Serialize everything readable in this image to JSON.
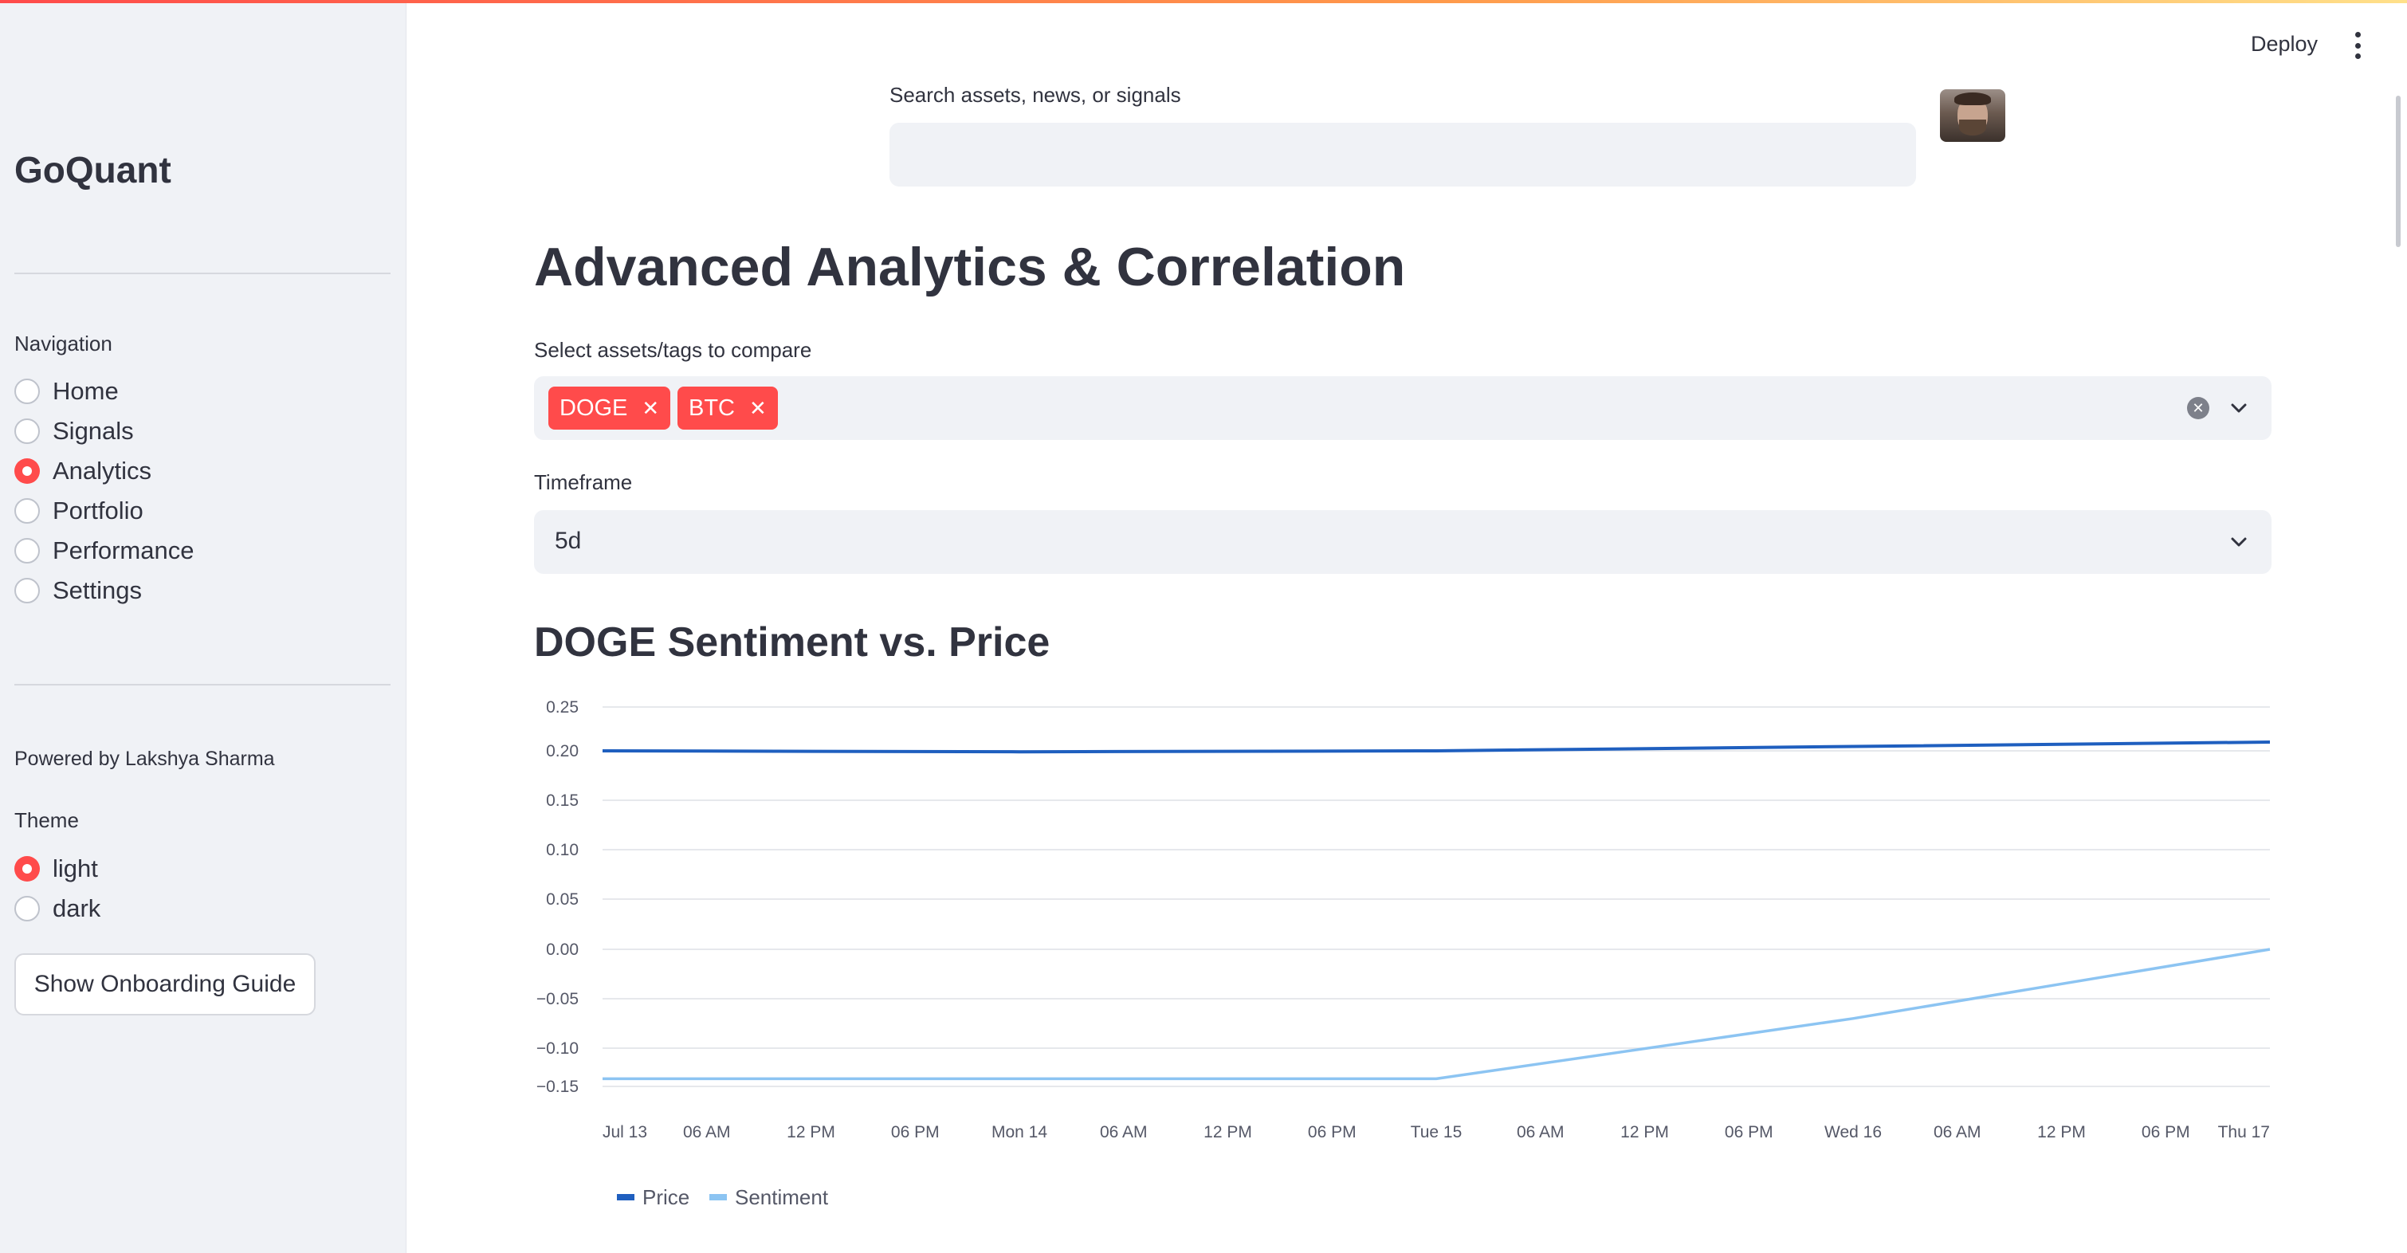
{
  "app": {
    "brand": "GoQuant",
    "deploy_label": "Deploy"
  },
  "sidebar": {
    "navigation_label": "Navigation",
    "nav_items": [
      {
        "label": "Home",
        "selected": false
      },
      {
        "label": "Signals",
        "selected": false
      },
      {
        "label": "Analytics",
        "selected": true
      },
      {
        "label": "Portfolio",
        "selected": false
      },
      {
        "label": "Performance",
        "selected": false
      },
      {
        "label": "Settings",
        "selected": false
      }
    ],
    "powered_by": "Powered by Lakshya Sharma",
    "theme_label": "Theme",
    "theme_options": [
      {
        "label": "light",
        "selected": true
      },
      {
        "label": "dark",
        "selected": false
      }
    ],
    "onboarding_button": "Show Onboarding Guide"
  },
  "search": {
    "label": "Search assets, news, or signals",
    "value": ""
  },
  "main": {
    "title": "Advanced Analytics & Correlation",
    "compare_label": "Select assets/tags to compare",
    "selected_tags": [
      "DOGE",
      "BTC"
    ],
    "timeframe_label": "Timeframe",
    "timeframe_value": "5d",
    "chart_title": "DOGE Sentiment vs. Price"
  },
  "colors": {
    "accent": "#ff4b4b",
    "price_line": "#1f5fbf",
    "sentiment_line": "#8cc4f2"
  },
  "chart_data": {
    "type": "line",
    "title": "DOGE Sentiment vs. Price",
    "x_ticks": [
      "Jul 13",
      "06 AM",
      "12 PM",
      "06 PM",
      "Mon 14",
      "06 AM",
      "12 PM",
      "06 PM",
      "Tue 15",
      "06 AM",
      "12 PM",
      "06 PM",
      "Wed 16",
      "06 AM",
      "12 PM",
      "06 PM",
      "Thu 17"
    ],
    "y_ticks": [
      "0.25",
      "0.20",
      "0.15",
      "0.10",
      "0.05",
      "0.00",
      "−0.05",
      "−0.10",
      "−0.15"
    ],
    "ylim": [
      -0.15,
      0.25
    ],
    "series": [
      {
        "name": "Price",
        "points": [
          [
            0,
            0.2
          ],
          [
            4,
            0.199
          ],
          [
            8,
            0.2
          ],
          [
            12,
            0.205
          ],
          [
            16,
            0.21
          ]
        ]
      },
      {
        "name": "Sentiment",
        "points": [
          [
            0,
            -0.14
          ],
          [
            4,
            -0.14
          ],
          [
            8,
            -0.14
          ],
          [
            12,
            -0.07
          ],
          [
            16,
            0.0
          ]
        ]
      }
    ],
    "legend": "bottom-left",
    "grid": true
  }
}
